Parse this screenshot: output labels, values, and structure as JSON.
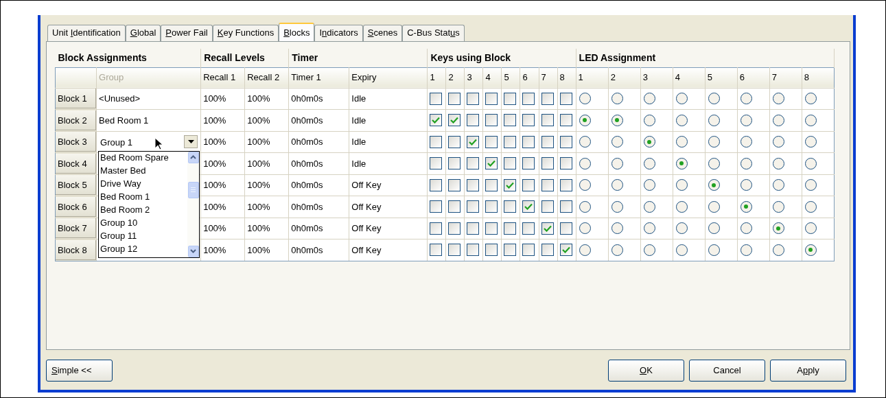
{
  "tabs": [
    {
      "before": "Unit ",
      "key": "I",
      "after": "dentification",
      "selected": false
    },
    {
      "key": "G",
      "after": "lobal",
      "selected": false
    },
    {
      "key": "P",
      "after": "ower Fail",
      "selected": false
    },
    {
      "key": "K",
      "after": "ey Functions",
      "selected": false
    },
    {
      "key": "B",
      "after": "locks",
      "selected": true
    },
    {
      "before": "I",
      "key": "n",
      "after": "dicators",
      "selected": false
    },
    {
      "key": "S",
      "after": "cenes",
      "selected": false
    },
    {
      "before": "C-Bus Stat",
      "key": "u",
      "after": "s",
      "selected": false
    }
  ],
  "table": {
    "group_headers": [
      "Block Assignments",
      "Recall Levels",
      "Timer",
      "Keys using Block",
      "LED Assignment"
    ],
    "columns": [
      "Group",
      "Recall 1",
      "Recall 2",
      "Timer 1",
      "Expiry"
    ],
    "key_columns": [
      "1",
      "2",
      "3",
      "4",
      "5",
      "6",
      "7",
      "8"
    ],
    "led_columns": [
      "1",
      "2",
      "3",
      "4",
      "5",
      "6",
      "7",
      "8"
    ],
    "rows": [
      {
        "label": "Block 1",
        "group": {
          "kind": "text",
          "value": "<Unused>"
        },
        "recall_1": "100%",
        "recall_2": "100%",
        "timer_1": "0h0m0s",
        "expiry": "Idle",
        "keys": [
          {
            "checked": false
          },
          {
            "checked": false
          },
          {
            "checked": false
          },
          {
            "checked": false
          },
          {
            "checked": false
          },
          {
            "checked": false
          },
          {
            "checked": false
          },
          {
            "checked": false
          }
        ],
        "leds": [
          {
            "selected": false
          },
          {
            "selected": false
          },
          {
            "selected": false
          },
          {
            "selected": false
          },
          {
            "selected": false
          },
          {
            "selected": false
          },
          {
            "selected": false
          },
          {
            "selected": false
          }
        ]
      },
      {
        "label": "Block 2",
        "group": {
          "kind": "text",
          "value": "Bed Room 1"
        },
        "recall_1": "100%",
        "recall_2": "100%",
        "timer_1": "0h0m0s",
        "expiry": "Idle",
        "keys": [
          {
            "checked": true
          },
          {
            "checked": true
          },
          {
            "checked": false
          },
          {
            "checked": false
          },
          {
            "checked": false
          },
          {
            "checked": false
          },
          {
            "checked": false
          },
          {
            "checked": false
          }
        ],
        "leds": [
          {
            "selected": true
          },
          {
            "selected": true
          },
          {
            "selected": false
          },
          {
            "selected": false
          },
          {
            "selected": false
          },
          {
            "selected": false
          },
          {
            "selected": false
          },
          {
            "selected": false
          }
        ]
      },
      {
        "label": "Block 3",
        "group": {
          "kind": "combo",
          "value": "Group 1",
          "items": [
            "Bed Room Spare",
            "Master Bed",
            "Drive Way",
            "Bed Room 1",
            "Bed Room 2",
            "Group 10",
            "Group 11",
            "Group 12"
          ]
        },
        "recall_1": "100%",
        "recall_2": "100%",
        "timer_1": "0h0m0s",
        "expiry": "Idle",
        "keys": [
          {
            "checked": false
          },
          {
            "checked": false
          },
          {
            "checked": true
          },
          {
            "checked": false
          },
          {
            "checked": false
          },
          {
            "checked": false
          },
          {
            "checked": false
          },
          {
            "checked": false
          }
        ],
        "leds": [
          {
            "selected": false
          },
          {
            "selected": false
          },
          {
            "selected": true
          },
          {
            "selected": false
          },
          {
            "selected": false
          },
          {
            "selected": false
          },
          {
            "selected": false
          },
          {
            "selected": false
          }
        ]
      },
      {
        "label": "Block 4",
        "recall_1": "100%",
        "recall_2": "100%",
        "timer_1": "0h0m0s",
        "expiry": "Idle",
        "keys": [
          {
            "checked": false
          },
          {
            "checked": false
          },
          {
            "checked": false
          },
          {
            "checked": true
          },
          {
            "checked": false
          },
          {
            "checked": false
          },
          {
            "checked": false
          },
          {
            "checked": false
          }
        ],
        "leds": [
          {
            "selected": false
          },
          {
            "selected": false
          },
          {
            "selected": false
          },
          {
            "selected": true
          },
          {
            "selected": false
          },
          {
            "selected": false
          },
          {
            "selected": false
          },
          {
            "selected": false
          }
        ]
      },
      {
        "label": "Block 5",
        "recall_1": "100%",
        "recall_2": "100%",
        "timer_1": "0h0m0s",
        "expiry": "Off Key",
        "keys": [
          {
            "checked": false
          },
          {
            "checked": false
          },
          {
            "checked": false
          },
          {
            "checked": false
          },
          {
            "checked": true
          },
          {
            "checked": false
          },
          {
            "checked": false
          },
          {
            "checked": false
          }
        ],
        "leds": [
          {
            "selected": false
          },
          {
            "selected": false
          },
          {
            "selected": false
          },
          {
            "selected": false
          },
          {
            "selected": true
          },
          {
            "selected": false
          },
          {
            "selected": false
          },
          {
            "selected": false
          }
        ]
      },
      {
        "label": "Block 6",
        "recall_1": "100%",
        "recall_2": "100%",
        "timer_1": "0h0m0s",
        "expiry": "Off Key",
        "keys": [
          {
            "checked": false
          },
          {
            "checked": false
          },
          {
            "checked": false
          },
          {
            "checked": false
          },
          {
            "checked": false
          },
          {
            "checked": true
          },
          {
            "checked": false
          },
          {
            "checked": false
          }
        ],
        "leds": [
          {
            "selected": false
          },
          {
            "selected": false
          },
          {
            "selected": false
          },
          {
            "selected": false
          },
          {
            "selected": false
          },
          {
            "selected": true
          },
          {
            "selected": false
          },
          {
            "selected": false
          }
        ]
      },
      {
        "label": "Block 7",
        "recall_1": "100%",
        "recall_2": "100%",
        "timer_1": "0h0m0s",
        "expiry": "Off Key",
        "keys": [
          {
            "checked": false
          },
          {
            "checked": false
          },
          {
            "checked": false
          },
          {
            "checked": false
          },
          {
            "checked": false
          },
          {
            "checked": false
          },
          {
            "checked": true
          },
          {
            "checked": false
          }
        ],
        "leds": [
          {
            "selected": false
          },
          {
            "selected": false
          },
          {
            "selected": false
          },
          {
            "selected": false
          },
          {
            "selected": false
          },
          {
            "selected": false
          },
          {
            "selected": true
          },
          {
            "selected": false
          }
        ]
      },
      {
        "label": "Block 8",
        "recall_1": "100%",
        "recall_2": "100%",
        "timer_1": "0h0m0s",
        "expiry": "Off Key",
        "keys": [
          {
            "checked": false
          },
          {
            "checked": false
          },
          {
            "checked": false
          },
          {
            "checked": false
          },
          {
            "checked": false
          },
          {
            "checked": false
          },
          {
            "checked": false
          },
          {
            "checked": true
          }
        ],
        "leds": [
          {
            "selected": false
          },
          {
            "selected": false
          },
          {
            "selected": false
          },
          {
            "selected": false
          },
          {
            "selected": false
          },
          {
            "selected": false
          },
          {
            "selected": false
          },
          {
            "selected": true
          }
        ]
      }
    ]
  },
  "left_buttons": [
    {
      "key": "S",
      "after": "imple <<"
    }
  ],
  "right_buttons": [
    {
      "key": "O",
      "after": "K"
    },
    {
      "before": "Cancel"
    },
    {
      "before": "A",
      "key": "p",
      "after": "ply"
    }
  ]
}
